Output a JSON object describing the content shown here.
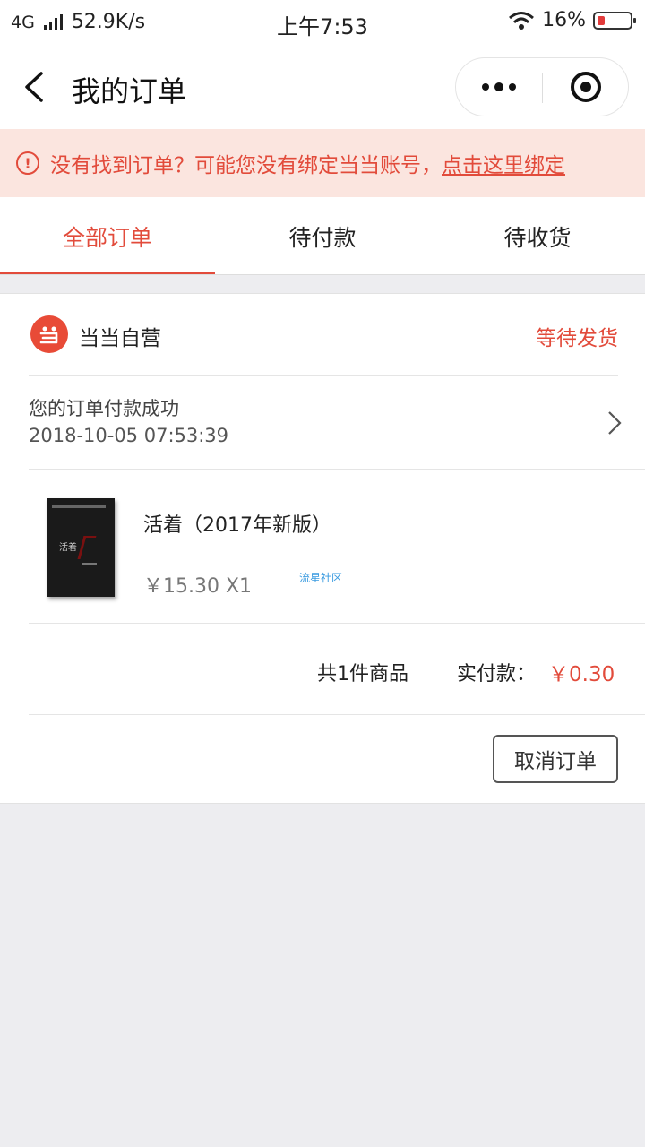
{
  "status_bar": {
    "network": "4G",
    "speed": "52.9K/s",
    "time": "上午7:53",
    "battery": "16%",
    "battery_level": 0.16
  },
  "header": {
    "title": "我的订单"
  },
  "notice": {
    "icon": "exclamation-circle-icon",
    "text": "没有找到订单？可能您没有绑定当当账号，",
    "link": "点击这里绑定",
    "color": "#e24b3b",
    "background": "#fbe5df"
  },
  "tabs": [
    {
      "label": "全部订单",
      "active": true
    },
    {
      "label": "待付款",
      "active": false
    },
    {
      "label": "待收货",
      "active": false
    }
  ],
  "order": {
    "shop_name": "当当自营",
    "status": "等待发货",
    "message": "您的订单付款成功",
    "time": "2018-10-05 07:53:39",
    "product": {
      "title": "活着（2017年新版）",
      "price_qty": "￥15.30 X1",
      "watermark": "流星社区"
    },
    "summary": {
      "count": "共1件商品",
      "paid_label": "实付款：",
      "paid_amount": "￥0.30"
    },
    "cancel_label": "取消订单"
  },
  "colors": {
    "accent": "#e24b3b",
    "background": "#ededf0"
  }
}
